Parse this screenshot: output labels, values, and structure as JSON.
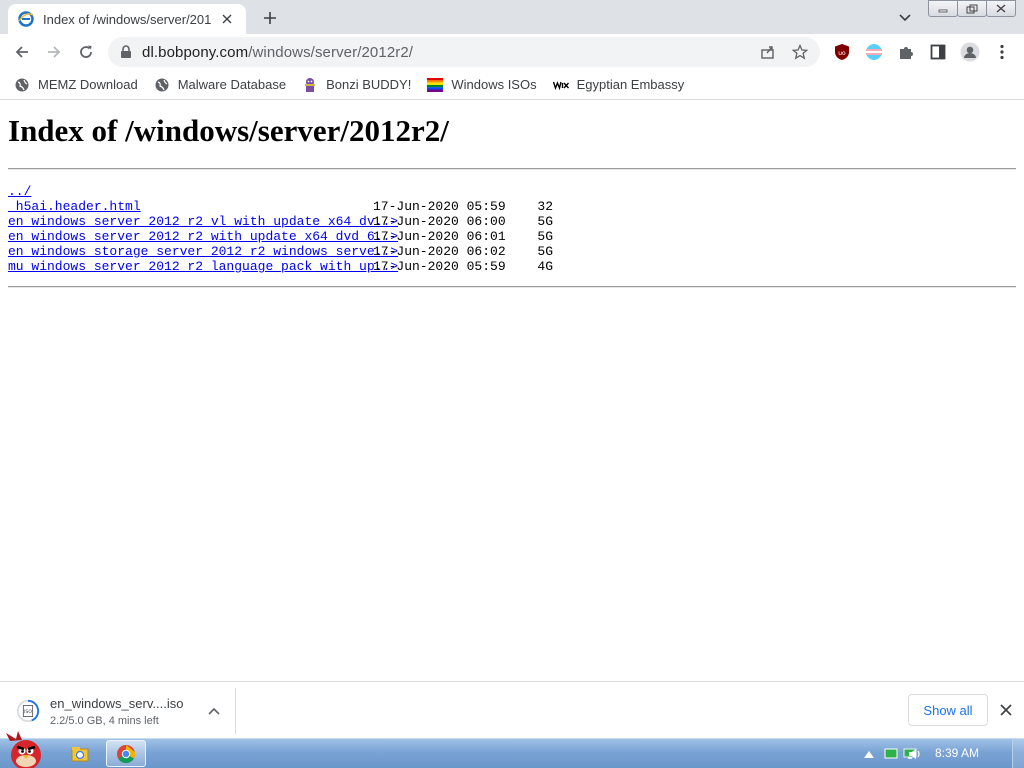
{
  "browser": {
    "tab": {
      "title": "Index of /windows/server/201",
      "favicon": "ie-icon"
    },
    "address": {
      "host": "dl.bobpony.com",
      "path": "/windows/server/2012r2/"
    },
    "bookmarks": [
      {
        "label": "MEMZ Download",
        "icon": "globe-icon"
      },
      {
        "label": "Malware Database",
        "icon": "globe-icon"
      },
      {
        "label": "Bonzi BUDDY!",
        "icon": "bonzi-icon"
      },
      {
        "label": "Windows ISOs",
        "icon": "rainbow-flag-icon"
      },
      {
        "label": "Egyptian Embassy",
        "icon": "wix-icon"
      }
    ]
  },
  "page": {
    "heading": "Index of /windows/server/2012r2/",
    "rows": [
      {
        "name": "../",
        "date": "",
        "size": ""
      },
      {
        "name": "_h5ai.header.html",
        "date": "17-Jun-2020 05:59",
        "size": "32"
      },
      {
        "name": "en_windows_server_2012_r2_vl_with_update_x64_dv..>",
        "date": "17-Jun-2020 06:00",
        "size": "5G"
      },
      {
        "name": "en_windows_server_2012_r2_with_update_x64_dvd_6..>",
        "date": "17-Jun-2020 06:01",
        "size": "5G"
      },
      {
        "name": "en_windows_storage_server_2012_r2_windows_serve..>",
        "date": "17-Jun-2020 06:02",
        "size": "5G"
      },
      {
        "name": "mu_windows_server_2012_r2_language_pack_with_up..>",
        "date": "17-Jun-2020 05:59",
        "size": "4G"
      }
    ]
  },
  "downloads": {
    "item": {
      "name": "en_windows_serv....iso",
      "status": "2.2/5.0 GB, 4 mins left",
      "progress_fraction": 0.44
    },
    "show_all_label": "Show all"
  },
  "taskbar": {
    "clock": "8:39 AM",
    "apps": [
      "explorer-icon",
      "chrome-icon"
    ],
    "tray": [
      "flag-icon",
      "network-icon",
      "volume-icon"
    ]
  },
  "colors": {
    "link": "#0000ee",
    "accent": "#1a73e8",
    "taskbar": "#7aa3d4"
  }
}
